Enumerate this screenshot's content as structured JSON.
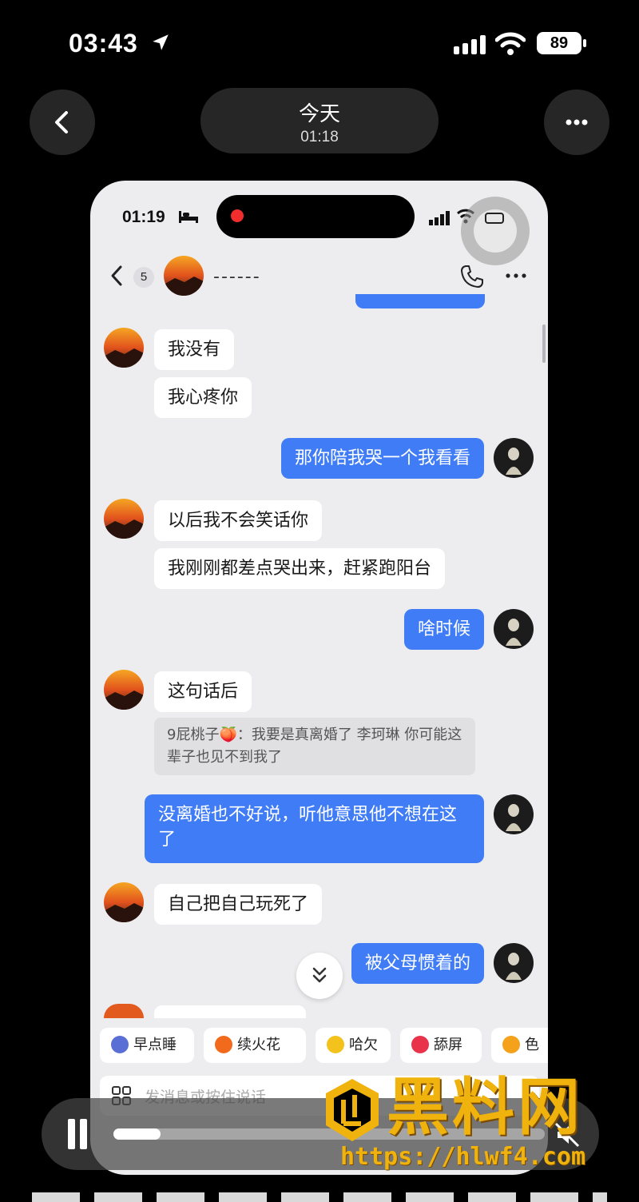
{
  "status_bar": {
    "time": "03:43",
    "battery": "89"
  },
  "viewer_header": {
    "title": "今天",
    "subtitle": "01:18"
  },
  "phone": {
    "status": {
      "time": "01:19"
    },
    "chat_header": {
      "unread_count": "5",
      "contact_name": "------"
    },
    "messages": [
      {
        "side": "left",
        "text": "我没有"
      },
      {
        "side": "left",
        "text": "我心疼你"
      },
      {
        "side": "right",
        "text": "那你陪我哭一个我看看"
      },
      {
        "side": "left",
        "text": "以后我不会笑话你"
      },
      {
        "side": "left",
        "text": "我刚刚都差点哭出来，赶紧跑阳台"
      },
      {
        "side": "right",
        "text": "啥时候"
      },
      {
        "side": "left",
        "text": "这句话后"
      },
      {
        "side": "quote",
        "text": "9屁桃子🍑：我要是真离婚了 李珂琳 你可能这辈子也见不到我了"
      },
      {
        "side": "right",
        "text": "没离婚也不好说，听他意思他不想在这了"
      },
      {
        "side": "left",
        "text": "自己把自己玩死了"
      },
      {
        "side": "right",
        "text": "被父母惯着的"
      }
    ],
    "quick_replies": [
      {
        "label": "早点睡",
        "color": "#5a6fd6"
      },
      {
        "label": "续火花",
        "color": "#f26b1d"
      },
      {
        "label": "哈欠",
        "color": "#f4c21c"
      },
      {
        "label": "舔屏",
        "color": "#e8334a"
      },
      {
        "label": "色",
        "color": "#f4a11c"
      }
    ],
    "input_placeholder": "发消息或按住说话"
  },
  "player": {
    "progress": 0.11
  },
  "watermark": {
    "text": "黑料网",
    "url": "https://hlwf4.com"
  },
  "colors": {
    "accent_blue": "#3f7cf5",
    "watermark_gold": "#f0b20c",
    "background": "#000000"
  }
}
